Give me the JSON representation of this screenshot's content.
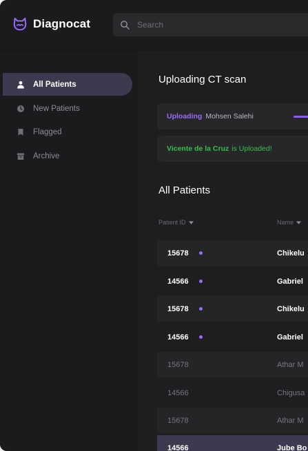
{
  "app": {
    "name": "Diagnocat",
    "search_placeholder": "Search"
  },
  "sidebar": {
    "items": [
      {
        "label": "All Patients",
        "icon": "user-icon",
        "active": true
      },
      {
        "label": "New Patients",
        "icon": "clock-icon",
        "active": false
      },
      {
        "label": "Flagged",
        "icon": "flag-icon",
        "active": false
      },
      {
        "label": "Archive",
        "icon": "archive-icon",
        "active": false
      }
    ]
  },
  "uploads": {
    "title": "Uploading CT scan",
    "in_progress": {
      "status": "Uploading",
      "name": "Mohsen Salehi"
    },
    "done": {
      "name": "Vicente de la Cruz",
      "status_text": "is Uploaded!"
    }
  },
  "patients": {
    "title": "All Patients",
    "columns": {
      "id": "Patient ID",
      "name": "Name"
    },
    "rows": [
      {
        "id": "15678",
        "name": "Chikelu",
        "unread": true
      },
      {
        "id": "14566",
        "name": "Gabriel",
        "unread": true
      },
      {
        "id": "15678",
        "name": "Chikelu",
        "unread": true
      },
      {
        "id": "14566",
        "name": "Gabriel",
        "unread": true
      },
      {
        "id": "15678",
        "name": "Athar M",
        "unread": false
      },
      {
        "id": "14566",
        "name": "Chigusa",
        "unread": false
      },
      {
        "id": "15678",
        "name": "Athar M",
        "unread": false
      },
      {
        "id": "14566",
        "name": "Jube Bo",
        "unread": false,
        "selected": true
      }
    ]
  },
  "colors": {
    "accent": "#9a6bff",
    "success": "#34c24a",
    "background": "#1e1e20",
    "active_item": "#3d3a4f"
  }
}
